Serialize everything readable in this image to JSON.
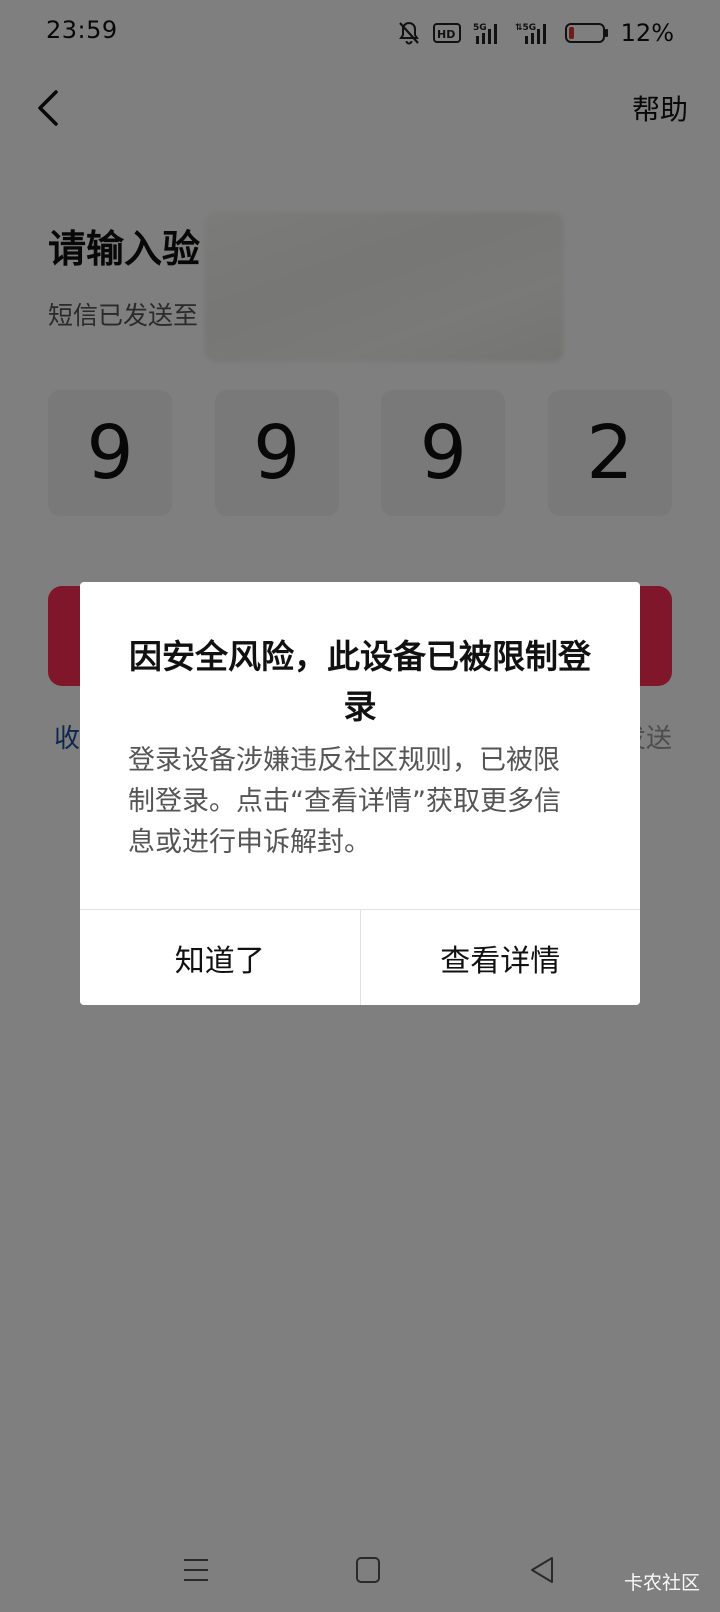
{
  "status_bar": {
    "time": "23:59",
    "battery_percent": "12%",
    "icons": [
      "mute-bell-icon",
      "hd-icon",
      "5g-signal-icon",
      "5g-signal-icon-2",
      "battery-icon"
    ]
  },
  "header": {
    "help_label": "帮助"
  },
  "page": {
    "title": "请输入验",
    "sent_hint": "短信已发送至",
    "code_digits": [
      "9",
      "9",
      "9",
      "2"
    ],
    "receive_issue_label": "收",
    "resend_label": "发送"
  },
  "dialog": {
    "title": "因安全风险，此设备已被限制登录",
    "message": "登录设备涉嫌违反社区规则，已被限制登录。点击“查看详情”获取更多信息或进行申诉解封。",
    "dismiss_label": "知道了",
    "details_label": "查看详情"
  },
  "watermark": "卡农社区",
  "colors": {
    "brand": "#fe2c55",
    "link": "#1a4fa0",
    "scrim": "rgba(0,0,0,0.5)",
    "battery_low": "#e53935"
  }
}
